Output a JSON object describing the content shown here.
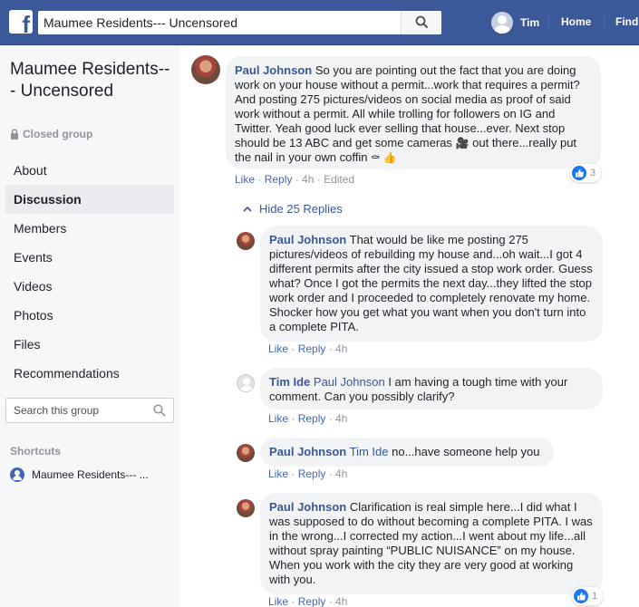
{
  "topbar": {
    "logo": "f",
    "search_value": "Maumee Residents--- Uncensored",
    "user_name": "Tim",
    "home_label": "Home",
    "find_label": "Find"
  },
  "sidebar": {
    "group_name": "Maumee Residents--- Uncensored",
    "privacy": "Closed group",
    "nav": [
      "About",
      "Discussion",
      "Members",
      "Events",
      "Videos",
      "Photos",
      "Files",
      "Recommendations"
    ],
    "active_nav": "Discussion",
    "search_placeholder": "Search this group",
    "shortcuts_heading": "Shortcuts",
    "shortcut_item": "Maumee Residents--- ..."
  },
  "comments": [
    {
      "author": "Paul Johnson",
      "text": "So you are pointing out the fact that you are doing work on your house without a permit...work that requires a permit? And posting 275 pictures/videos on social media as proof of said work without a permit. All while trolling for followers on IG and Twitter. Yeah good luck ever selling that house...ever. Next stop should be 13 ABC and get some cameras",
      "text_tail": "out there...really put the nail in your own coffin",
      "like": "Like",
      "reply": "Reply",
      "time": "4h",
      "edited": "Edited",
      "reactions": "3"
    }
  ],
  "hide_replies": "Hide 25 Replies",
  "replies": [
    {
      "author": "Paul Johnson",
      "mention": "",
      "text": "That would be like me posting 275 pictures/videos of rebuilding my house and...oh wait...I got 4 different permits after the city issued a stop work order. Guess what? Once I got the permits the next day...they lifted the stop work order and I proceeded to completely renovate my home. Shocker how you get what you want when you don't turn into a complete PITA.",
      "like": "Like",
      "reply": "Reply",
      "time": "4h"
    },
    {
      "author": "Tim Ide",
      "mention": "Paul Johnson",
      "text": "I am having a tough time with your comment. Can you possibly clarify?",
      "like": "Like",
      "reply": "Reply",
      "time": "4h"
    },
    {
      "author": "Paul Johnson",
      "mention": "Tim Ide",
      "text": "no...have someone help you",
      "like": "Like",
      "reply": "Reply",
      "time": "4h"
    },
    {
      "author": "Paul Johnson",
      "mention": "",
      "text": "Clarification is real simple here...I did what I was supposed to do without becoming a complete PITA. I was in the wrong...I corrected my action...I went about my life...all without spray painting “PUBLIC NUISANCE” on my house. When you work with the city they are very good at working with you.",
      "like": "Like",
      "reply": "Reply",
      "time": "4h",
      "reactions": "1"
    }
  ],
  "colors": {
    "brand": "#3b5998",
    "link": "#385898",
    "bubble": "#f2f3f5",
    "meta": "#90949c"
  }
}
